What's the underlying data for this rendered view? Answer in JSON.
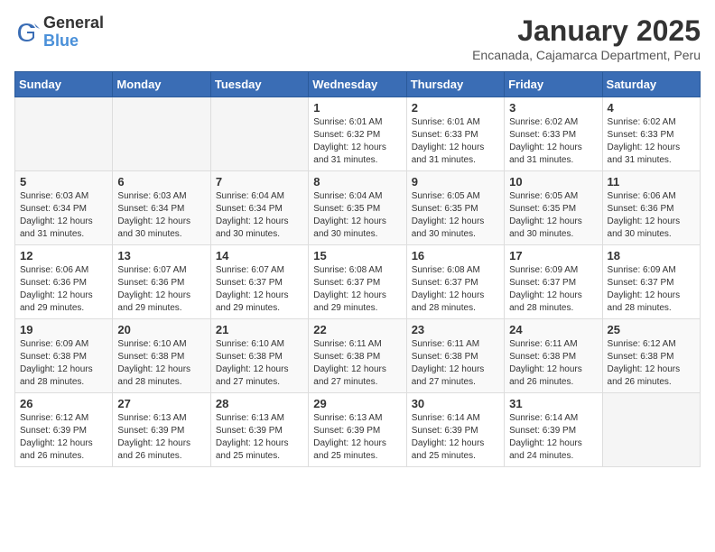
{
  "header": {
    "logo_general": "General",
    "logo_blue": "Blue",
    "month_title": "January 2025",
    "subtitle": "Encanada, Cajamarca Department, Peru"
  },
  "weekdays": [
    "Sunday",
    "Monday",
    "Tuesday",
    "Wednesday",
    "Thursday",
    "Friday",
    "Saturday"
  ],
  "weeks": [
    [
      {
        "day": "",
        "info": ""
      },
      {
        "day": "",
        "info": ""
      },
      {
        "day": "",
        "info": ""
      },
      {
        "day": "1",
        "info": "Sunrise: 6:01 AM\nSunset: 6:32 PM\nDaylight: 12 hours\nand 31 minutes."
      },
      {
        "day": "2",
        "info": "Sunrise: 6:01 AM\nSunset: 6:33 PM\nDaylight: 12 hours\nand 31 minutes."
      },
      {
        "day": "3",
        "info": "Sunrise: 6:02 AM\nSunset: 6:33 PM\nDaylight: 12 hours\nand 31 minutes."
      },
      {
        "day": "4",
        "info": "Sunrise: 6:02 AM\nSunset: 6:33 PM\nDaylight: 12 hours\nand 31 minutes."
      }
    ],
    [
      {
        "day": "5",
        "info": "Sunrise: 6:03 AM\nSunset: 6:34 PM\nDaylight: 12 hours\nand 31 minutes."
      },
      {
        "day": "6",
        "info": "Sunrise: 6:03 AM\nSunset: 6:34 PM\nDaylight: 12 hours\nand 30 minutes."
      },
      {
        "day": "7",
        "info": "Sunrise: 6:04 AM\nSunset: 6:34 PM\nDaylight: 12 hours\nand 30 minutes."
      },
      {
        "day": "8",
        "info": "Sunrise: 6:04 AM\nSunset: 6:35 PM\nDaylight: 12 hours\nand 30 minutes."
      },
      {
        "day": "9",
        "info": "Sunrise: 6:05 AM\nSunset: 6:35 PM\nDaylight: 12 hours\nand 30 minutes."
      },
      {
        "day": "10",
        "info": "Sunrise: 6:05 AM\nSunset: 6:35 PM\nDaylight: 12 hours\nand 30 minutes."
      },
      {
        "day": "11",
        "info": "Sunrise: 6:06 AM\nSunset: 6:36 PM\nDaylight: 12 hours\nand 30 minutes."
      }
    ],
    [
      {
        "day": "12",
        "info": "Sunrise: 6:06 AM\nSunset: 6:36 PM\nDaylight: 12 hours\nand 29 minutes."
      },
      {
        "day": "13",
        "info": "Sunrise: 6:07 AM\nSunset: 6:36 PM\nDaylight: 12 hours\nand 29 minutes."
      },
      {
        "day": "14",
        "info": "Sunrise: 6:07 AM\nSunset: 6:37 PM\nDaylight: 12 hours\nand 29 minutes."
      },
      {
        "day": "15",
        "info": "Sunrise: 6:08 AM\nSunset: 6:37 PM\nDaylight: 12 hours\nand 29 minutes."
      },
      {
        "day": "16",
        "info": "Sunrise: 6:08 AM\nSunset: 6:37 PM\nDaylight: 12 hours\nand 28 minutes."
      },
      {
        "day": "17",
        "info": "Sunrise: 6:09 AM\nSunset: 6:37 PM\nDaylight: 12 hours\nand 28 minutes."
      },
      {
        "day": "18",
        "info": "Sunrise: 6:09 AM\nSunset: 6:37 PM\nDaylight: 12 hours\nand 28 minutes."
      }
    ],
    [
      {
        "day": "19",
        "info": "Sunrise: 6:09 AM\nSunset: 6:38 PM\nDaylight: 12 hours\nand 28 minutes."
      },
      {
        "day": "20",
        "info": "Sunrise: 6:10 AM\nSunset: 6:38 PM\nDaylight: 12 hours\nand 28 minutes."
      },
      {
        "day": "21",
        "info": "Sunrise: 6:10 AM\nSunset: 6:38 PM\nDaylight: 12 hours\nand 27 minutes."
      },
      {
        "day": "22",
        "info": "Sunrise: 6:11 AM\nSunset: 6:38 PM\nDaylight: 12 hours\nand 27 minutes."
      },
      {
        "day": "23",
        "info": "Sunrise: 6:11 AM\nSunset: 6:38 PM\nDaylight: 12 hours\nand 27 minutes."
      },
      {
        "day": "24",
        "info": "Sunrise: 6:11 AM\nSunset: 6:38 PM\nDaylight: 12 hours\nand 26 minutes."
      },
      {
        "day": "25",
        "info": "Sunrise: 6:12 AM\nSunset: 6:38 PM\nDaylight: 12 hours\nand 26 minutes."
      }
    ],
    [
      {
        "day": "26",
        "info": "Sunrise: 6:12 AM\nSunset: 6:39 PM\nDaylight: 12 hours\nand 26 minutes."
      },
      {
        "day": "27",
        "info": "Sunrise: 6:13 AM\nSunset: 6:39 PM\nDaylight: 12 hours\nand 26 minutes."
      },
      {
        "day": "28",
        "info": "Sunrise: 6:13 AM\nSunset: 6:39 PM\nDaylight: 12 hours\nand 25 minutes."
      },
      {
        "day": "29",
        "info": "Sunrise: 6:13 AM\nSunset: 6:39 PM\nDaylight: 12 hours\nand 25 minutes."
      },
      {
        "day": "30",
        "info": "Sunrise: 6:14 AM\nSunset: 6:39 PM\nDaylight: 12 hours\nand 25 minutes."
      },
      {
        "day": "31",
        "info": "Sunrise: 6:14 AM\nSunset: 6:39 PM\nDaylight: 12 hours\nand 24 minutes."
      },
      {
        "day": "",
        "info": ""
      }
    ]
  ]
}
